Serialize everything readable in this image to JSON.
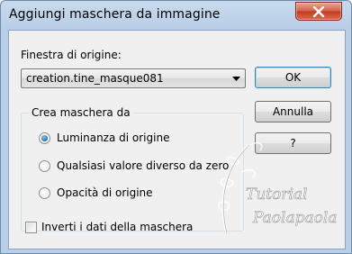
{
  "window": {
    "title": "Aggiungi maschera da immagine"
  },
  "source": {
    "label": "Finestra di origine:",
    "selected": "creation.tine_masque081"
  },
  "group": {
    "title": "Crea maschera da",
    "options": [
      {
        "label": "Luminanza di origine",
        "checked": true
      },
      {
        "label": "Qualsiasi valore diverso da zero",
        "checked": false
      },
      {
        "label": "Opacità di origine",
        "checked": false
      }
    ]
  },
  "invert": {
    "label": "Inverti i dati della maschera",
    "checked": false
  },
  "buttons": {
    "ok": "OK",
    "cancel": "Annulla",
    "help": "?"
  },
  "watermark": {
    "line1": "Tutorial",
    "line2": "Paolapaola"
  },
  "colors": {
    "titlebar": "#b9cfe7",
    "client": "#f0f0f0",
    "close": "#c23c22",
    "accent": "#1b6cb0"
  }
}
